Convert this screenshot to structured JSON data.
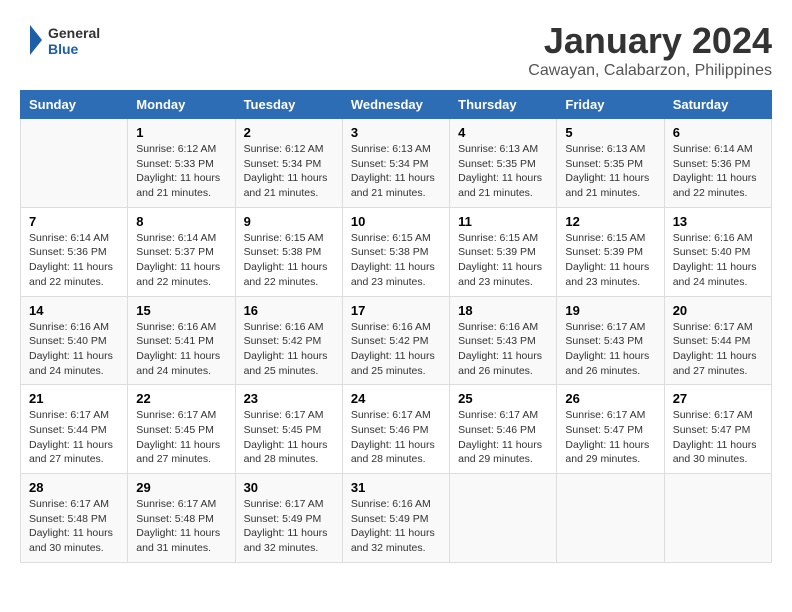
{
  "logo": {
    "line1": "General",
    "line2": "Blue"
  },
  "title": "January 2024",
  "subtitle": "Cawayan, Calabarzon, Philippines",
  "days_header": [
    "Sunday",
    "Monday",
    "Tuesday",
    "Wednesday",
    "Thursday",
    "Friday",
    "Saturday"
  ],
  "weeks": [
    [
      {
        "num": "",
        "info": ""
      },
      {
        "num": "1",
        "info": "Sunrise: 6:12 AM\nSunset: 5:33 PM\nDaylight: 11 hours and 21 minutes."
      },
      {
        "num": "2",
        "info": "Sunrise: 6:12 AM\nSunset: 5:34 PM\nDaylight: 11 hours and 21 minutes."
      },
      {
        "num": "3",
        "info": "Sunrise: 6:13 AM\nSunset: 5:34 PM\nDaylight: 11 hours and 21 minutes."
      },
      {
        "num": "4",
        "info": "Sunrise: 6:13 AM\nSunset: 5:35 PM\nDaylight: 11 hours and 21 minutes."
      },
      {
        "num": "5",
        "info": "Sunrise: 6:13 AM\nSunset: 5:35 PM\nDaylight: 11 hours and 21 minutes."
      },
      {
        "num": "6",
        "info": "Sunrise: 6:14 AM\nSunset: 5:36 PM\nDaylight: 11 hours and 22 minutes."
      }
    ],
    [
      {
        "num": "7",
        "info": "Sunrise: 6:14 AM\nSunset: 5:36 PM\nDaylight: 11 hours and 22 minutes."
      },
      {
        "num": "8",
        "info": "Sunrise: 6:14 AM\nSunset: 5:37 PM\nDaylight: 11 hours and 22 minutes."
      },
      {
        "num": "9",
        "info": "Sunrise: 6:15 AM\nSunset: 5:38 PM\nDaylight: 11 hours and 22 minutes."
      },
      {
        "num": "10",
        "info": "Sunrise: 6:15 AM\nSunset: 5:38 PM\nDaylight: 11 hours and 23 minutes."
      },
      {
        "num": "11",
        "info": "Sunrise: 6:15 AM\nSunset: 5:39 PM\nDaylight: 11 hours and 23 minutes."
      },
      {
        "num": "12",
        "info": "Sunrise: 6:15 AM\nSunset: 5:39 PM\nDaylight: 11 hours and 23 minutes."
      },
      {
        "num": "13",
        "info": "Sunrise: 6:16 AM\nSunset: 5:40 PM\nDaylight: 11 hours and 24 minutes."
      }
    ],
    [
      {
        "num": "14",
        "info": "Sunrise: 6:16 AM\nSunset: 5:40 PM\nDaylight: 11 hours and 24 minutes."
      },
      {
        "num": "15",
        "info": "Sunrise: 6:16 AM\nSunset: 5:41 PM\nDaylight: 11 hours and 24 minutes."
      },
      {
        "num": "16",
        "info": "Sunrise: 6:16 AM\nSunset: 5:42 PM\nDaylight: 11 hours and 25 minutes."
      },
      {
        "num": "17",
        "info": "Sunrise: 6:16 AM\nSunset: 5:42 PM\nDaylight: 11 hours and 25 minutes."
      },
      {
        "num": "18",
        "info": "Sunrise: 6:16 AM\nSunset: 5:43 PM\nDaylight: 11 hours and 26 minutes."
      },
      {
        "num": "19",
        "info": "Sunrise: 6:17 AM\nSunset: 5:43 PM\nDaylight: 11 hours and 26 minutes."
      },
      {
        "num": "20",
        "info": "Sunrise: 6:17 AM\nSunset: 5:44 PM\nDaylight: 11 hours and 27 minutes."
      }
    ],
    [
      {
        "num": "21",
        "info": "Sunrise: 6:17 AM\nSunset: 5:44 PM\nDaylight: 11 hours and 27 minutes."
      },
      {
        "num": "22",
        "info": "Sunrise: 6:17 AM\nSunset: 5:45 PM\nDaylight: 11 hours and 27 minutes."
      },
      {
        "num": "23",
        "info": "Sunrise: 6:17 AM\nSunset: 5:45 PM\nDaylight: 11 hours and 28 minutes."
      },
      {
        "num": "24",
        "info": "Sunrise: 6:17 AM\nSunset: 5:46 PM\nDaylight: 11 hours and 28 minutes."
      },
      {
        "num": "25",
        "info": "Sunrise: 6:17 AM\nSunset: 5:46 PM\nDaylight: 11 hours and 29 minutes."
      },
      {
        "num": "26",
        "info": "Sunrise: 6:17 AM\nSunset: 5:47 PM\nDaylight: 11 hours and 29 minutes."
      },
      {
        "num": "27",
        "info": "Sunrise: 6:17 AM\nSunset: 5:47 PM\nDaylight: 11 hours and 30 minutes."
      }
    ],
    [
      {
        "num": "28",
        "info": "Sunrise: 6:17 AM\nSunset: 5:48 PM\nDaylight: 11 hours and 30 minutes."
      },
      {
        "num": "29",
        "info": "Sunrise: 6:17 AM\nSunset: 5:48 PM\nDaylight: 11 hours and 31 minutes."
      },
      {
        "num": "30",
        "info": "Sunrise: 6:17 AM\nSunset: 5:49 PM\nDaylight: 11 hours and 32 minutes."
      },
      {
        "num": "31",
        "info": "Sunrise: 6:16 AM\nSunset: 5:49 PM\nDaylight: 11 hours and 32 minutes."
      },
      {
        "num": "",
        "info": ""
      },
      {
        "num": "",
        "info": ""
      },
      {
        "num": "",
        "info": ""
      }
    ]
  ]
}
